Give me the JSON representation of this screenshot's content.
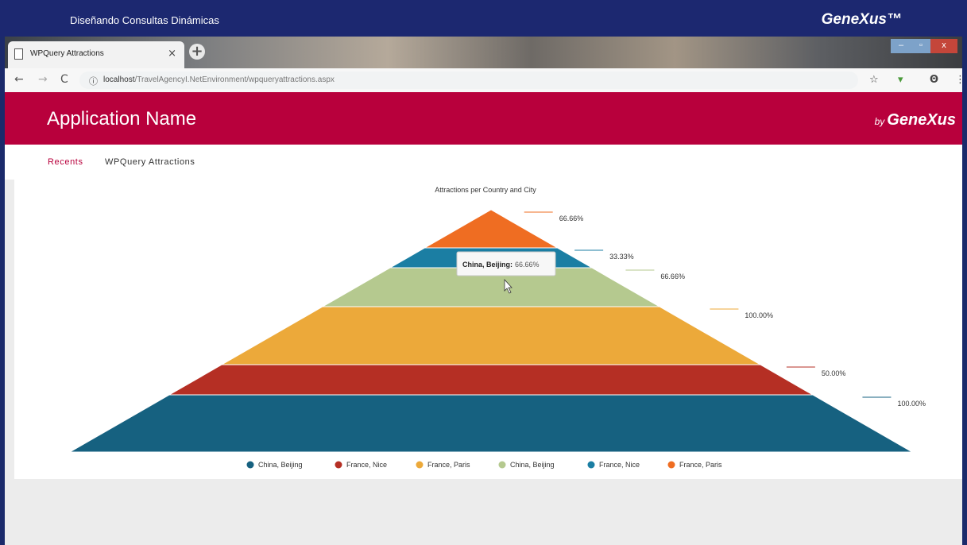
{
  "banner": {
    "title": "Diseñando Consultas Dinámicas",
    "logo": "GeneXus™"
  },
  "browser": {
    "tab_label": "WPQuery Attractions",
    "tab_close": "×",
    "new_tab": "+",
    "url_host": "localhost",
    "url_path": "/TravelAgencyI.NetEnvironment/wpqueryattractions.aspx",
    "icons": [
      "back-icon",
      "forward-icon",
      "reload-icon",
      "info-icon",
      "star-icon",
      "extension-icon",
      "account-icon",
      "menu-icon"
    ]
  },
  "app": {
    "name": "Application Name",
    "by": "by",
    "brand": "GeneXus"
  },
  "breadcrumb": {
    "recents": "Recents",
    "current": "WPQuery Attractions"
  },
  "colors": {
    "accent": "#b8003c",
    "banner": "#1c2870"
  },
  "tooltip": {
    "label": "China, Beijing:",
    "value": "66.66%"
  },
  "chart_data": {
    "type": "pyramid",
    "title": "Attractions per Country and City",
    "categories": [
      "China, Beijing",
      "France, Nice",
      "France, Paris",
      "China, Beijing",
      "France, Nice",
      "France, Paris"
    ],
    "values": [
      100.0,
      50.0,
      100.0,
      66.66,
      33.33,
      66.66
    ],
    "labels": [
      "100.00%",
      "50.00%",
      "100.00%",
      "66.66%",
      "33.33%",
      "66.66%"
    ],
    "colors": [
      "#166180",
      "#b52f24",
      "#eca93a",
      "#b5c98f",
      "#1b7ea3",
      "#ef6d22"
    ],
    "legend_position": "bottom"
  }
}
